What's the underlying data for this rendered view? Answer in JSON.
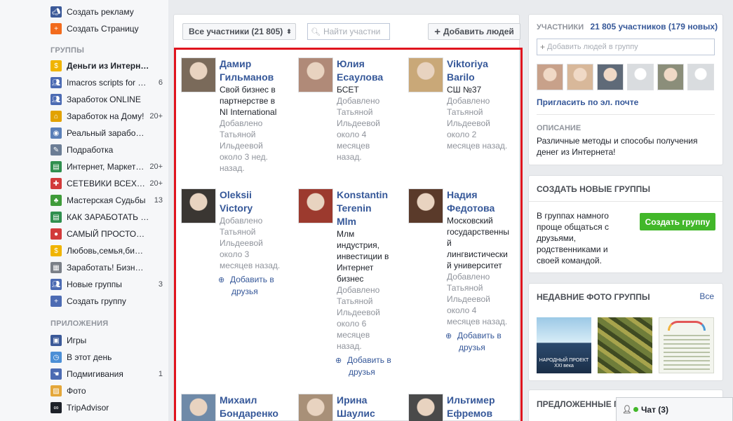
{
  "sidebar": {
    "top_items": [
      {
        "label": "Создать рекламу",
        "icon": "megaphone-icon",
        "color": "#3b5998"
      },
      {
        "label": "Создать Страницу",
        "icon": "flag-plus-icon",
        "color": "#f26b1d"
      }
    ],
    "groups_header": "ГРУППЫ",
    "groups": [
      {
        "label": "Деньги из Интерн…",
        "count": "",
        "icon": "coin-icon",
        "color": "#f0b400",
        "bold": true
      },
      {
        "label": "Imacros scripts for …",
        "count": "6",
        "icon": "group-icon",
        "color": "#4c6bb3"
      },
      {
        "label": "Заработок ONLINE",
        "count": "",
        "icon": "group-icon",
        "color": "#4c6bb3"
      },
      {
        "label": "Заработок на Дому!",
        "count": "20+",
        "icon": "house-icon",
        "color": "#e2a200"
      },
      {
        "label": "Реальный зарабо…",
        "count": "",
        "icon": "globe-icon",
        "color": "#5a7fb8"
      },
      {
        "label": "Подработка",
        "count": "",
        "icon": "tools-icon",
        "color": "#6b7d95"
      },
      {
        "label": "Интернет, Маркет…",
        "count": "20+",
        "icon": "notebook-icon",
        "color": "#2f8f4e"
      },
      {
        "label": "СЕТЕВИКИ ВСЕХ…",
        "count": "20+",
        "icon": "gift-icon",
        "color": "#d23b3b"
      },
      {
        "label": "Мастерская Судьбы",
        "count": "13",
        "icon": "tree-icon",
        "color": "#3f9b3a"
      },
      {
        "label": "КАК ЗАРАБОТАТЬ …",
        "count": "",
        "icon": "notebook-icon",
        "color": "#2f8f4e"
      },
      {
        "label": "САМЫЙ ПРОСТО…",
        "count": "",
        "icon": "apple-icon",
        "color": "#d23b3b"
      },
      {
        "label": "Любовь,семья,би…",
        "count": "",
        "icon": "coin-icon",
        "color": "#f0b400"
      },
      {
        "label": "Заработать! Бизн…",
        "count": "",
        "icon": "calculator-icon",
        "color": "#7a7f87"
      },
      {
        "label": "Новые группы",
        "count": "3",
        "icon": "group-icon",
        "color": "#4c6bb3"
      },
      {
        "label": "Создать группу",
        "count": "",
        "icon": "plus-icon",
        "color": "#4c6bb3"
      }
    ],
    "apps_header": "ПРИЛОЖЕНИЯ",
    "apps": [
      {
        "label": "Игры",
        "count": "",
        "icon": "games-icon",
        "color": "#3b5998"
      },
      {
        "label": "В этот день",
        "count": "",
        "icon": "clock-icon",
        "color": "#4c8fd6"
      },
      {
        "label": "Подмигивания",
        "count": "1",
        "icon": "poke-icon",
        "color": "#4c6bb3"
      },
      {
        "label": "Фото",
        "count": "",
        "icon": "photo-icon",
        "color": "#e4a73a"
      },
      {
        "label": "TripAdvisor",
        "count": "",
        "icon": "owl-icon",
        "color": "#1d2129"
      }
    ]
  },
  "toolbar": {
    "filter_label": "Все участники (21 805)",
    "search_placeholder": "Найти участни",
    "add_people_label": "Добавить людей"
  },
  "members": [
    {
      "name1": "Дамир",
      "name2": "Гильманов",
      "name3": "",
      "desc": [
        "Свой бизнес в",
        "партнерстве в",
        "NI International"
      ],
      "added": [
        "Добавлено",
        "Татьяной",
        "Ильдеевой",
        "около 3 нед.",
        "назад."
      ],
      "addfr": "",
      "addfr2": "",
      "photo": "#7a6a5a"
    },
    {
      "name1": "Юлия",
      "name2": "Есаулова",
      "name3": "",
      "desc": [
        "БСЕТ"
      ],
      "added": [
        "Добавлено",
        "Татьяной",
        "Ильдеевой",
        "около 4",
        "месяцев",
        "назад."
      ],
      "addfr": "",
      "addfr2": "",
      "photo": "#b08a78"
    },
    {
      "name1": "Viktoriya",
      "name2": "Barilo",
      "name3": "",
      "desc": [
        "СШ №37"
      ],
      "added": [
        "Добавлено",
        "Татьяной",
        "Ильдеевой",
        "около 2",
        "месяцев назад."
      ],
      "addfr": "",
      "addfr2": "",
      "photo": "#c9a878"
    },
    {
      "name1": "Oleksii",
      "name2": "Victory",
      "name3": "",
      "desc": [],
      "added": [
        "Добавлено",
        "Татьяной",
        "Ильдеевой",
        "около 3",
        "месяцев назад."
      ],
      "addfr": "Добавить в",
      "addfr2": "друзья",
      "photo": "#3a3632"
    },
    {
      "name1": "Konstantin",
      "name2": "Terenin",
      "name3": "Mlm",
      "desc": [
        "Млм",
        "индустрия,",
        "инвестиции в",
        "Интернет",
        "бизнес"
      ],
      "added": [
        "Добавлено",
        "Татьяной",
        "Ильдеевой",
        "около 6",
        "месяцев",
        "назад."
      ],
      "addfr": "Добавить в",
      "addfr2": "друзья",
      "photo": "#9c3a2e"
    },
    {
      "name1": "Надия",
      "name2": "Федотова",
      "name3": "",
      "desc": [
        "Московский",
        "государственны",
        "й",
        "лингвистически",
        "й университет"
      ],
      "added": [
        "Добавлено",
        "Татьяной",
        "Ильдеевой",
        "около 4",
        "месяцев назад."
      ],
      "addfr": "Добавить в",
      "addfr2": "друзья",
      "photo": "#5a3a2a"
    },
    {
      "name1": "Михаил",
      "name2": "Бондаренко",
      "name3": "",
      "desc": [],
      "added": [],
      "addfr": "",
      "addfr2": "",
      "photo": "#6f8aa8"
    },
    {
      "name1": "Ирина",
      "name2": "Шаулис",
      "name3": "",
      "desc": [],
      "added": [],
      "addfr": "",
      "addfr2": "",
      "photo": "#a89078"
    },
    {
      "name1": "Ильтимер",
      "name2": "Ефремов",
      "name3": "",
      "desc": [],
      "added": [],
      "addfr": "",
      "addfr2": "",
      "photo": "#4a4a4a"
    }
  ],
  "right": {
    "members_title": "УЧАСТНИКИ",
    "members_count": "21 805 участников (179 новых)",
    "add_placeholder": "Добавить людей в группу",
    "invite_label": "Пригласить по эл. почте",
    "description_title": "ОПИСАНИЕ",
    "description_text": [
      "Различные методы и способы получения",
      "денег из Интернета!"
    ],
    "create_title": "СОЗДАТЬ НОВЫЕ ГРУППЫ",
    "create_text": [
      "В группах намного",
      "проще общаться с",
      "друзьями,",
      "родственниками и",
      "своей командой."
    ],
    "create_button": "Создать группу",
    "photos_title": "НЕДАВНИЕ ФОТО ГРУППЫ",
    "photos_all": "Все",
    "photo1_caption": "НАРОДНЫЙ ПРОЕКТ XXI века",
    "suggested_title": "ПРЕДЛОЖЕННЫЕ ГРУ"
  },
  "chat": {
    "label": "Чат (3)"
  }
}
